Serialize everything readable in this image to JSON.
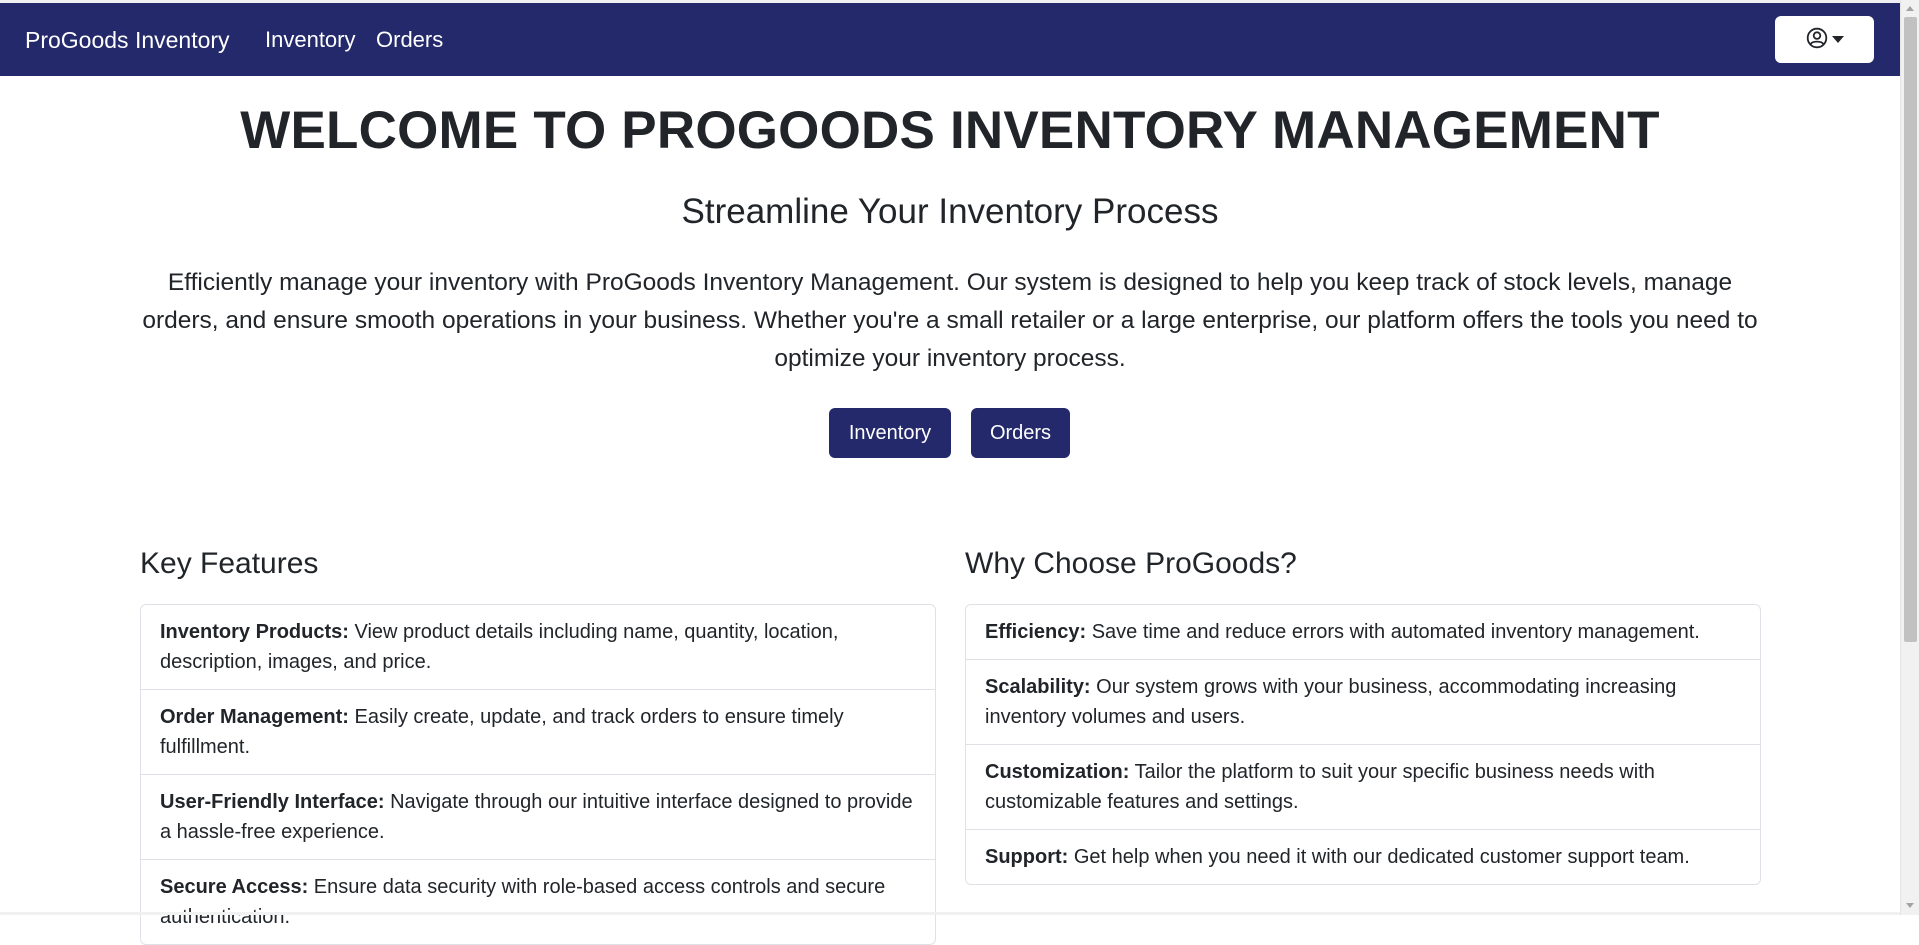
{
  "navbar": {
    "brand": "ProGoods Inventory",
    "links": [
      "Inventory",
      "Orders"
    ],
    "user_menu_icon": "user-circle-icon"
  },
  "hero": {
    "title": "WELCOME TO PROGOODS INVENTORY MANAGEMENT",
    "subtitle": "Streamline Your Inventory Process",
    "description": "Efficiently manage your inventory with ProGoods Inventory Management. Our system is designed to help you keep track of stock levels, manage orders, and ensure smooth operations in your business. Whether you're a small retailer or a large enterprise, our platform offers the tools you need to optimize your inventory process.",
    "buttons": [
      "Inventory",
      "Orders"
    ]
  },
  "features": {
    "title": "Key Features",
    "items": [
      {
        "label": "Inventory Products:",
        "text": " View product details including name, quantity, location, description, images, and price."
      },
      {
        "label": "Order Management:",
        "text": " Easily create, update, and track orders to ensure timely fulfillment."
      },
      {
        "label": "User-Friendly Interface:",
        "text": " Navigate through our intuitive interface designed to provide a hassle-free experience."
      },
      {
        "label": "Secure Access:",
        "text": " Ensure data security with role-based access controls and secure authentication."
      }
    ]
  },
  "why": {
    "title": "Why Choose ProGoods?",
    "items": [
      {
        "label": "Efficiency:",
        "text": " Save time and reduce errors with automated inventory management."
      },
      {
        "label": "Scalability:",
        "text": " Our system grows with your business, accommodating increasing inventory volumes and users."
      },
      {
        "label": "Customization:",
        "text": " Tailor the platform to suit your specific business needs with customizable features and settings."
      },
      {
        "label": "Support:",
        "text": " Get help when you need it with our dedicated customer support team."
      }
    ]
  },
  "colors": {
    "navbar": "#23296a",
    "button": "#23296a",
    "text": "#212529",
    "border": "#dee2e6"
  }
}
